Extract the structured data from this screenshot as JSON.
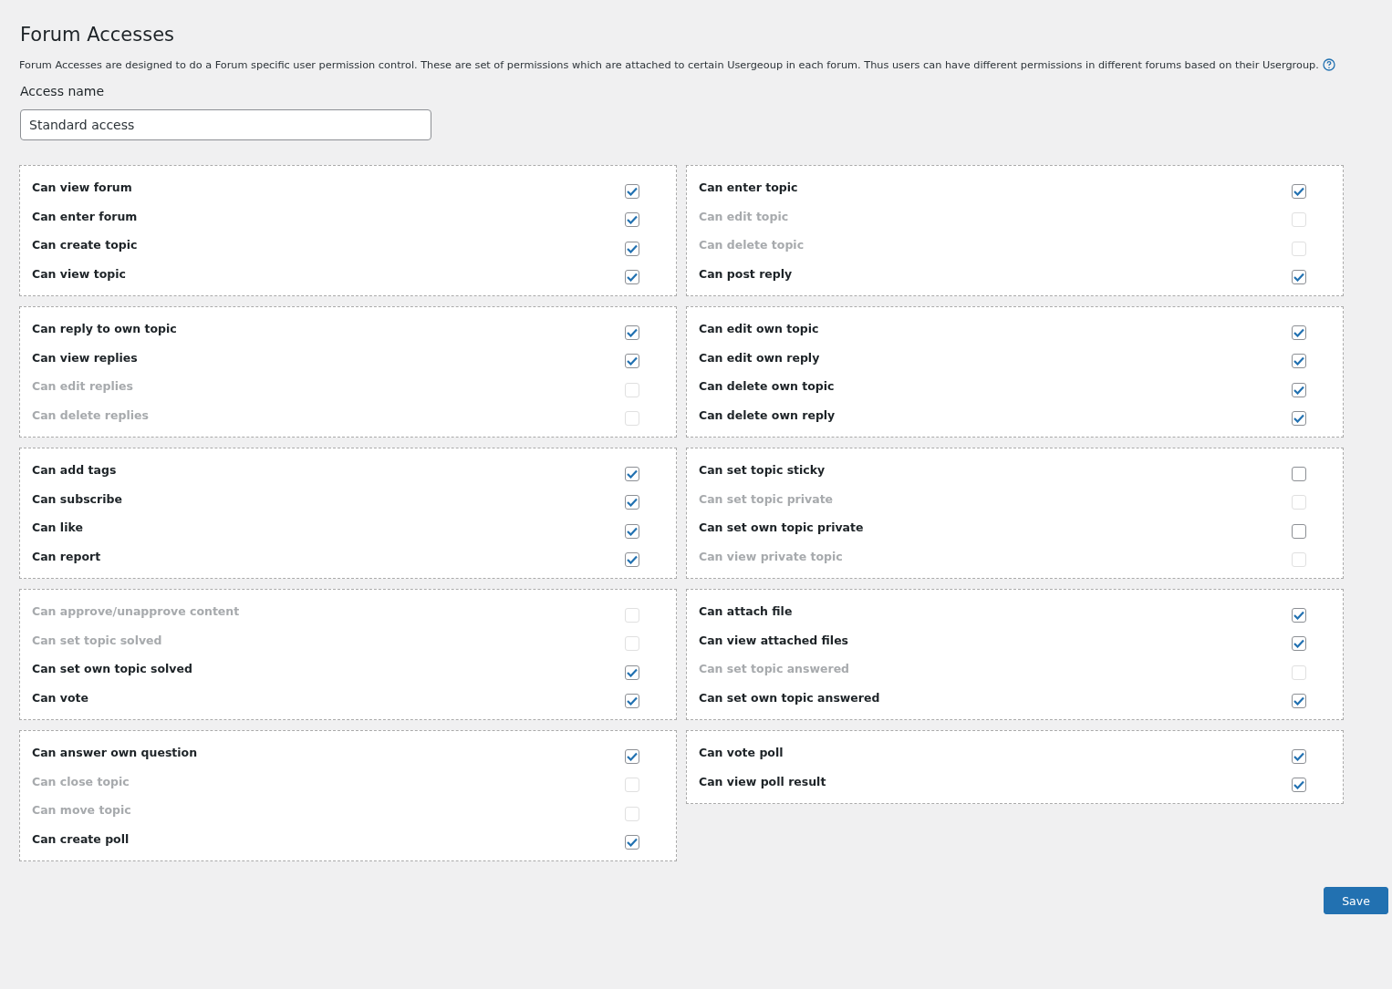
{
  "title": "Forum Accesses",
  "description": "Forum Accesses are designed to do a Forum specific user permission control. These are set of permissions which are attached to certain Usergeoup in each forum. Thus users can have different permissions in different forums based on their Usergroup.",
  "access_name": {
    "label": "Access name",
    "value": "Standard access"
  },
  "groups": [
    {
      "items": [
        {
          "label": "Can view forum",
          "checked": true,
          "disabled": false
        },
        {
          "label": "Can enter forum",
          "checked": true,
          "disabled": false
        },
        {
          "label": "Can create topic",
          "checked": true,
          "disabled": false
        },
        {
          "label": "Can view topic",
          "checked": true,
          "disabled": false
        }
      ]
    },
    {
      "items": [
        {
          "label": "Can enter topic",
          "checked": true,
          "disabled": false
        },
        {
          "label": "Can edit topic",
          "checked": false,
          "disabled": true
        },
        {
          "label": "Can delete topic",
          "checked": false,
          "disabled": true
        },
        {
          "label": "Can post reply",
          "checked": true,
          "disabled": false
        }
      ]
    },
    {
      "items": [
        {
          "label": "Can reply to own topic",
          "checked": true,
          "disabled": false
        },
        {
          "label": "Can view replies",
          "checked": true,
          "disabled": false
        },
        {
          "label": "Can edit replies",
          "checked": false,
          "disabled": true
        },
        {
          "label": "Can delete replies",
          "checked": false,
          "disabled": true
        }
      ]
    },
    {
      "items": [
        {
          "label": "Can edit own topic",
          "checked": true,
          "disabled": false
        },
        {
          "label": "Can edit own reply",
          "checked": true,
          "disabled": false
        },
        {
          "label": "Can delete own topic",
          "checked": true,
          "disabled": false
        },
        {
          "label": "Can delete own reply",
          "checked": true,
          "disabled": false
        }
      ]
    },
    {
      "items": [
        {
          "label": "Can add tags",
          "checked": true,
          "disabled": false
        },
        {
          "label": "Can subscribe",
          "checked": true,
          "disabled": false
        },
        {
          "label": "Can like",
          "checked": true,
          "disabled": false
        },
        {
          "label": "Can report",
          "checked": true,
          "disabled": false
        }
      ]
    },
    {
      "items": [
        {
          "label": "Can set topic sticky",
          "checked": false,
          "disabled": false
        },
        {
          "label": "Can set topic private",
          "checked": false,
          "disabled": true
        },
        {
          "label": "Can set own topic private",
          "checked": false,
          "disabled": false
        },
        {
          "label": "Can view private topic",
          "checked": false,
          "disabled": true
        }
      ]
    },
    {
      "items": [
        {
          "label": "Can approve/unapprove content",
          "checked": false,
          "disabled": true
        },
        {
          "label": "Can set topic solved",
          "checked": false,
          "disabled": true
        },
        {
          "label": "Can set own topic solved",
          "checked": true,
          "disabled": false
        },
        {
          "label": "Can vote",
          "checked": true,
          "disabled": false
        }
      ]
    },
    {
      "items": [
        {
          "label": "Can attach file",
          "checked": true,
          "disabled": false
        },
        {
          "label": "Can view attached files",
          "checked": true,
          "disabled": false
        },
        {
          "label": "Can set topic answered",
          "checked": false,
          "disabled": true
        },
        {
          "label": "Can set own topic answered",
          "checked": true,
          "disabled": false
        }
      ]
    },
    {
      "items": [
        {
          "label": "Can answer own question",
          "checked": true,
          "disabled": false
        },
        {
          "label": "Can close topic",
          "checked": false,
          "disabled": true
        },
        {
          "label": "Can move topic",
          "checked": false,
          "disabled": true
        },
        {
          "label": "Can create poll",
          "checked": true,
          "disabled": false
        }
      ]
    },
    {
      "items": [
        {
          "label": "Can vote poll",
          "checked": true,
          "disabled": false
        },
        {
          "label": "Can view poll result",
          "checked": true,
          "disabled": false
        }
      ]
    }
  ],
  "save_button": "Save"
}
